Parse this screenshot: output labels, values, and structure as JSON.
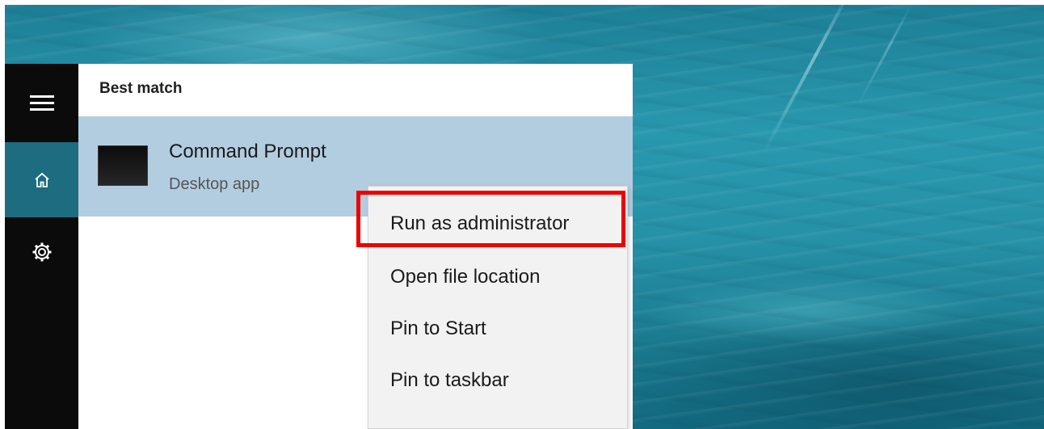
{
  "start_menu": {
    "rail": {
      "menu_icon": "hamburger-menu-icon",
      "home_icon": "home-icon",
      "settings_icon": "gear-icon"
    },
    "results": {
      "section_header": "Best match",
      "best_match": {
        "name": "Command Prompt",
        "type": "Desktop app",
        "icon": "command-prompt-icon"
      }
    },
    "context_menu": {
      "items": [
        "Run as administrator",
        "Open file location",
        "Pin to Start",
        "Pin to taskbar"
      ]
    }
  },
  "annotation": {
    "highlight_color": "#ee0000"
  },
  "colors": {
    "rail_background": "#0b0b0b",
    "rail_selected": "#1e6c80",
    "result_selected": "#b3cde0",
    "menu_background": "#f2f2f2"
  }
}
